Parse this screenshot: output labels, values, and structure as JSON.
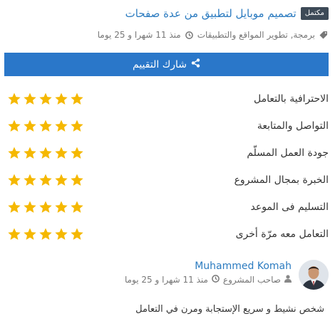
{
  "project": {
    "status_badge": "مكتمل",
    "title": "تصميم موبايل لتطبيق من عدة صفحات",
    "category": "برمجة, تطوير المواقع والتطبيقات",
    "time_ago": "منذ 11 شهرا و 25 يوما"
  },
  "share_button": {
    "label": "شارك التقييم",
    "icon": "share-icon"
  },
  "ratings": [
    {
      "label": "الاحترافية بالتعامل",
      "stars": 5
    },
    {
      "label": "التواصل والمتابعة",
      "stars": 5
    },
    {
      "label": "جودة العمل المسلّم",
      "stars": 5
    },
    {
      "label": "الخبرة بمجال المشروع",
      "stars": 5
    },
    {
      "label": "التسليم فى الموعد",
      "stars": 5
    },
    {
      "label": "التعامل معه مرّة أخرى",
      "stars": 5
    }
  ],
  "review": {
    "reviewer_name": "Muhammed Komah",
    "role": "صاحب المشروع",
    "time_ago": "منذ 11 شهرا و 25 يوما",
    "text": "شخص نشيط و سريع الإستجابة ومرن في التعامل"
  },
  "colors": {
    "accent": "#2a77c9",
    "link": "#2b7bc0",
    "star": "#f5b800",
    "badge": "#3d4a57"
  }
}
